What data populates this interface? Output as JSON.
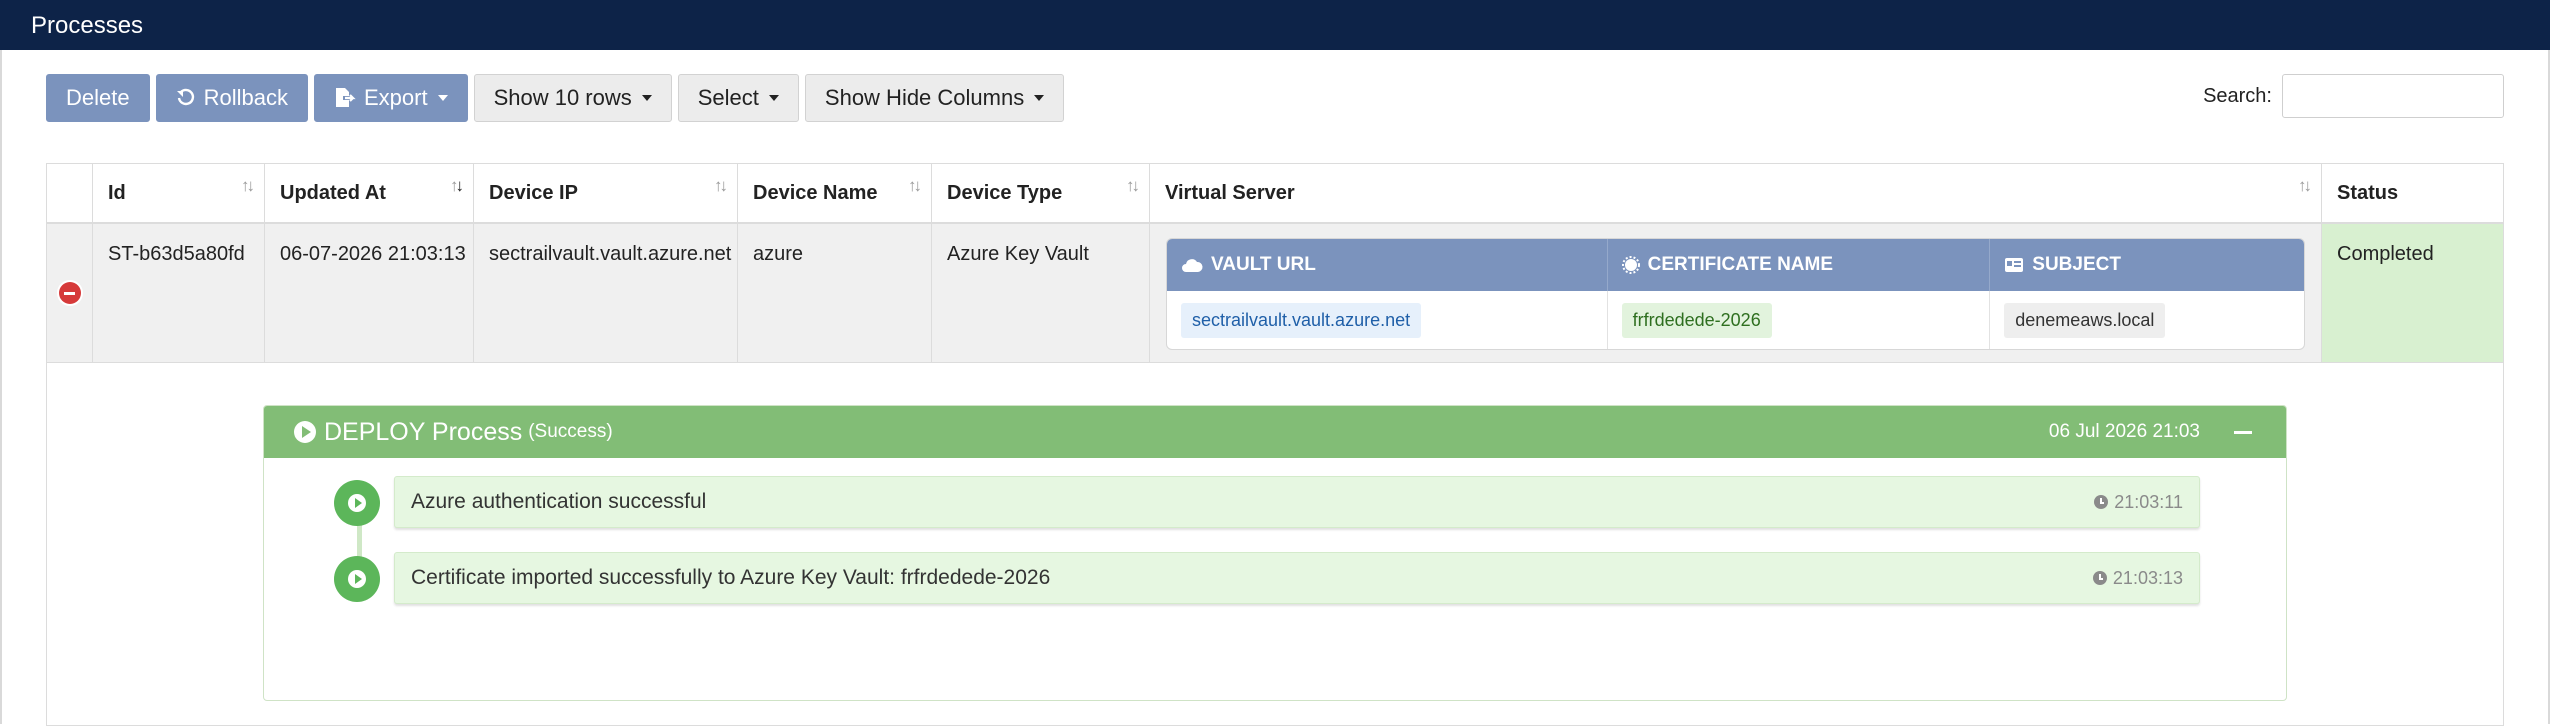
{
  "window": {
    "title": "Processes"
  },
  "toolbar": {
    "delete_label": "Delete",
    "rollback_label": "Rollback",
    "export_label": "Export",
    "show_rows_label": "Show 10 rows",
    "select_label": "Select",
    "columns_label": "Show Hide Columns"
  },
  "search": {
    "label": "Search:",
    "value": "",
    "placeholder": ""
  },
  "table": {
    "columns": [
      "Id",
      "Updated At",
      "Device IP",
      "Device Name",
      "Device Type",
      "Virtual Server",
      "Status"
    ],
    "rows": [
      {
        "id": "ST-b63d5a80fd",
        "updated_at": "06-07-2026 21:03:13",
        "device_ip": "sectrailvault.vault.azure.net",
        "device_name": "azure",
        "device_type": "Azure Key Vault",
        "virtual_server": {
          "headers": [
            "VAULT URL",
            "CERTIFICATE NAME",
            "SUBJECT"
          ],
          "vault_url": "sectrailvault.vault.azure.net",
          "certificate_name": "frfrdedede-2026",
          "subject": "denemeaws.local"
        },
        "status": "Completed"
      }
    ]
  },
  "process": {
    "title": "DEPLOY Process",
    "result": "(Success)",
    "time": "06 Jul 2026 21:03",
    "steps": [
      {
        "text": "Azure authentication successful",
        "time": "21:03:11"
      },
      {
        "text": "Certificate imported successfully to Azure Key Vault: frfrdedede-2026",
        "time": "21:03:13"
      }
    ]
  },
  "colors": {
    "titlebar": "#0d2348",
    "button_primary": "#7b93bd",
    "success": "#82bd76",
    "danger": "#d63a3a"
  }
}
